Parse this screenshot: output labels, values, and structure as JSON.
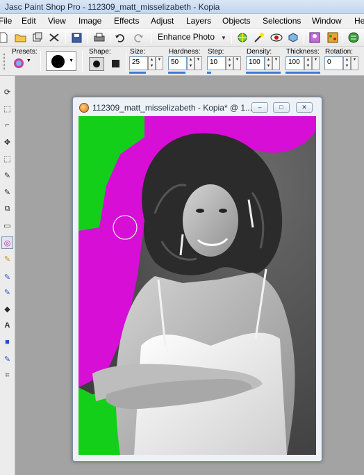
{
  "app": {
    "title": "Jasc Paint Shop Pro - 112309_matt_misselizabeth - Kopia"
  },
  "menu": {
    "items": [
      "File",
      "Edit",
      "View",
      "Image",
      "Effects",
      "Adjust",
      "Layers",
      "Objects",
      "Selections",
      "Window",
      "He"
    ]
  },
  "toolbar": {
    "enhance_label": "Enhance Photo",
    "icons": [
      "new-icon",
      "open-icon",
      "browse-icon",
      "scan-icon",
      "save-icon",
      "print-icon",
      "undo-icon",
      "redo-icon",
      "enhance-dropdown-icon",
      "one-step-icon",
      "auto-fix-icon",
      "red-eye-icon",
      "cube-icon",
      "layers-icon",
      "palette-icon",
      "globe-icon"
    ]
  },
  "options": {
    "presets_label": "Presets:",
    "shape_label": "Shape:",
    "size_label": "Size:",
    "size_value": "25",
    "hardness_label": "Hardness:",
    "hardness_value": "50",
    "step_label": "Step:",
    "step_value": "10",
    "density_label": "Density:",
    "density_value": "100",
    "thickness_label": "Thickness:",
    "thickness_value": "100",
    "rotation_label": "Rotation:",
    "rotation_value": "0"
  },
  "image_window": {
    "title": "112309_matt_misselizabeth - Kopia* @ 1...",
    "minimize": "–",
    "maximize": "□",
    "close": "✕"
  },
  "colors": {
    "green": "#13cf1a",
    "magenta": "#d60ed6",
    "accent": "#3a7bd5"
  }
}
